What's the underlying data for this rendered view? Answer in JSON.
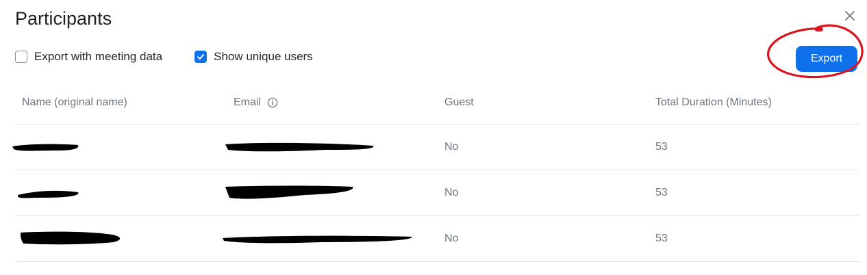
{
  "dialog": {
    "title": "Participants",
    "close_icon": "close-icon"
  },
  "options": {
    "export_meeting_data": {
      "label": "Export with meeting data",
      "checked": false
    },
    "show_unique_users": {
      "label": "Show unique users",
      "checked": true
    }
  },
  "export_button": {
    "label": "Export",
    "color": "#0e71eb"
  },
  "annotation": {
    "color": "#d9141e",
    "shape": "hand-drawn circle around Export button"
  },
  "table": {
    "headers": [
      "Name (original name)",
      "Email",
      "Guest",
      "Total Duration (Minutes)"
    ],
    "email_info_icon": "info-icon",
    "rows": [
      {
        "name": "",
        "email": "",
        "guest": "No",
        "duration": "53"
      },
      {
        "name": "",
        "email": "",
        "guest": "No",
        "duration": "53"
      },
      {
        "name": "",
        "email": "",
        "guest": "No",
        "duration": "53"
      }
    ]
  },
  "colors": {
    "accent": "#0e71eb",
    "header_text": "#6e7680",
    "divider": "#e4e4e4"
  }
}
